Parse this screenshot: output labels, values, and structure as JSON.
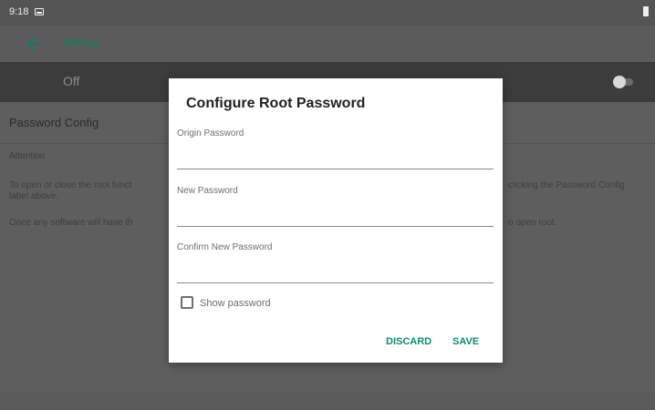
{
  "status_bar": {
    "time": "9:18",
    "icons": [
      "image-notification-icon",
      "battery-icon"
    ]
  },
  "app_bar": {
    "title": "Settings",
    "back_icon": "arrow-left-icon"
  },
  "switch_row": {
    "label": "Off",
    "checked": false
  },
  "config_row": {
    "label": "Password Config"
  },
  "attention": {
    "title": "Attention",
    "line1_left": "To open or close the root funct",
    "line1_right": "clicking the Password Config",
    "line1_cont": "label above.",
    "line2_left": "Once any software will have th",
    "line2_right": "o open root."
  },
  "dialog": {
    "title": "Configure Root Password",
    "fields": [
      {
        "label": "Origin Password",
        "value": ""
      },
      {
        "label": "New Password",
        "value": ""
      },
      {
        "label": "Confirm New Password",
        "value": ""
      }
    ],
    "show_password_label": "Show password",
    "show_password_checked": false,
    "discard_label": "DISCARD",
    "save_label": "SAVE"
  },
  "colors": {
    "accent": "#0e8a74",
    "scrim_bg": "#5e5e5e",
    "dialog_bg": "#ffffff"
  }
}
